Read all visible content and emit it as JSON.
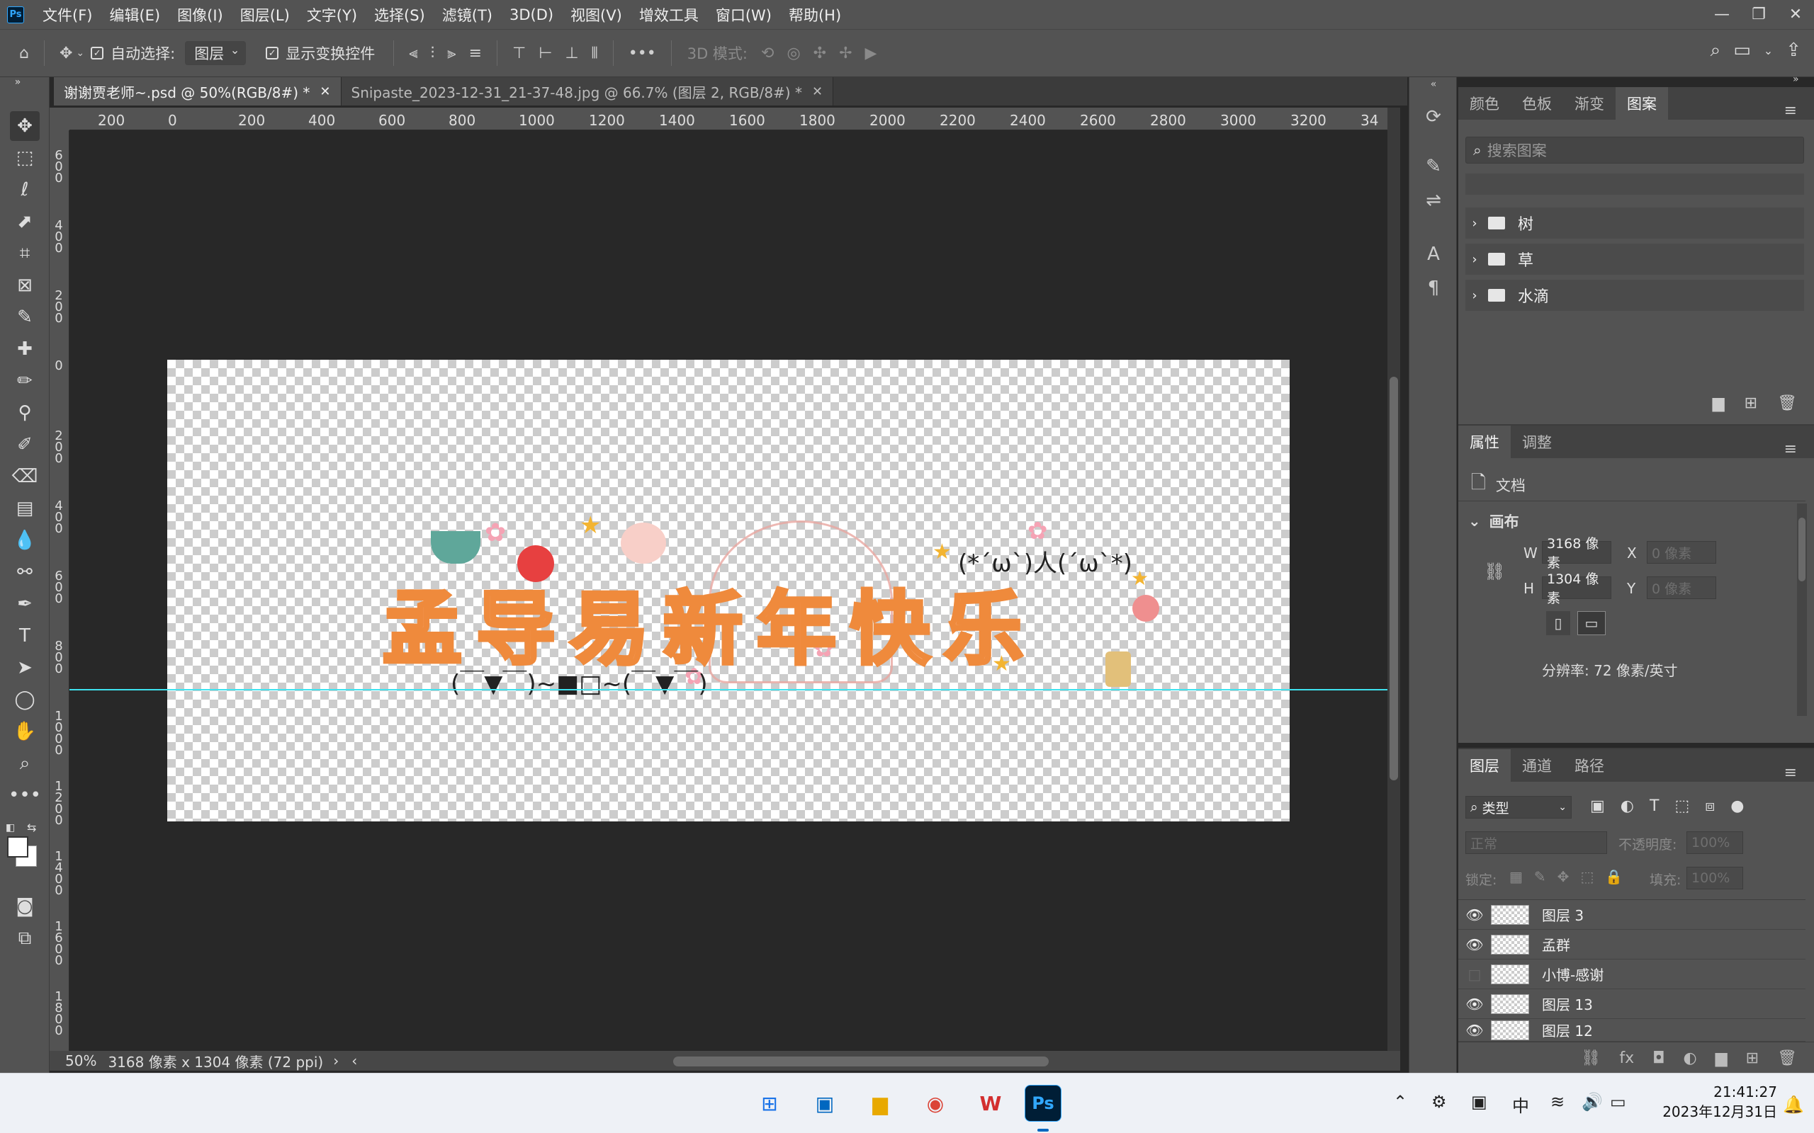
{
  "app": {
    "logo": "Ps"
  },
  "menu": [
    "文件(F)",
    "编辑(E)",
    "图像(I)",
    "图层(L)",
    "文字(Y)",
    "选择(S)",
    "滤镜(T)",
    "3D(D)",
    "视图(V)",
    "增效工具",
    "窗口(W)",
    "帮助(H)"
  ],
  "window_controls": {
    "minimize": "—",
    "restore": "❐",
    "close": "✕"
  },
  "options": {
    "auto_select_label": "自动选择:",
    "auto_select_value": "图层",
    "show_transform_label": "显示变换控件",
    "more": "•••",
    "mode3d": "3D 模式:"
  },
  "tabs": [
    {
      "label": "谢谢贾老师~.psd @ 50%(RGB/8#) *",
      "active": true
    },
    {
      "label": "Snipaste_2023-12-31_21-37-48.jpg @ 66.7% (图层 2, RGB/8#) *",
      "active": false
    }
  ],
  "ruler_h": [
    "200",
    "0",
    "200",
    "400",
    "600",
    "800",
    "1000",
    "1200",
    "1400",
    "1600",
    "1800",
    "2000",
    "2200",
    "2400",
    "2600",
    "2800",
    "3000",
    "3200",
    "34"
  ],
  "ruler_v": [
    "6\n0\n0",
    "4\n0\n0",
    "2\n0\n0",
    "0",
    "2\n0\n0",
    "4\n0\n0",
    "6\n0\n0",
    "8\n0\n0",
    "1\n0\n0\n0",
    "1\n2\n0\n0",
    "1\n4\n0\n0",
    "1\n6\n0\n0",
    "1\n8\n0\n0"
  ],
  "artwork": {
    "title_text": "孟导易新年快乐",
    "kaomoji_left": "(￣▼￣)~■□~(￣▼￣)",
    "kaomoji_right": "(*´ω`)人(´ω`*)"
  },
  "status": {
    "zoom": "50%",
    "doc_info": "3168 像素 x 1304 像素 (72 ppi)"
  },
  "patterns_panel": {
    "tabs": [
      "颜色",
      "色板",
      "渐变",
      "图案"
    ],
    "active_tab": "图案",
    "search_placeholder": "搜索图案",
    "groups": [
      "树",
      "草",
      "水滴"
    ]
  },
  "properties_panel": {
    "tabs": [
      "属性",
      "调整"
    ],
    "doc_label": "文档",
    "canvas_label": "画布",
    "w_label": "W",
    "w_value": "3168 像素",
    "h_label": "H",
    "h_value": "1304 像素",
    "x_label": "X",
    "x_value": "0 像素",
    "y_label": "Y",
    "y_value": "0 像素",
    "resolution": "分辨率: 72 像素/英寸"
  },
  "layers_panel": {
    "tabs": [
      "图层",
      "通道",
      "路径"
    ],
    "filter_label": "类型",
    "blend_mode": "正常",
    "opacity_label": "不透明度:",
    "opacity_value": "100%",
    "lock_label": "锁定:",
    "fill_label": "填充:",
    "fill_value": "100%",
    "layers": [
      {
        "name": "图层 3",
        "visible": true
      },
      {
        "name": "孟群",
        "visible": true
      },
      {
        "name": "小博-感谢",
        "visible": false
      },
      {
        "name": "图层 13",
        "visible": true
      },
      {
        "name": "图层 12",
        "visible": true
      }
    ]
  },
  "taskbar": {
    "ime": "中",
    "time": "21:41:27",
    "date": "2023年12月31日"
  },
  "colors": {
    "accent": "#31a8ff",
    "guide": "#3fe3ef",
    "title_orange": "#ef8a3c"
  }
}
